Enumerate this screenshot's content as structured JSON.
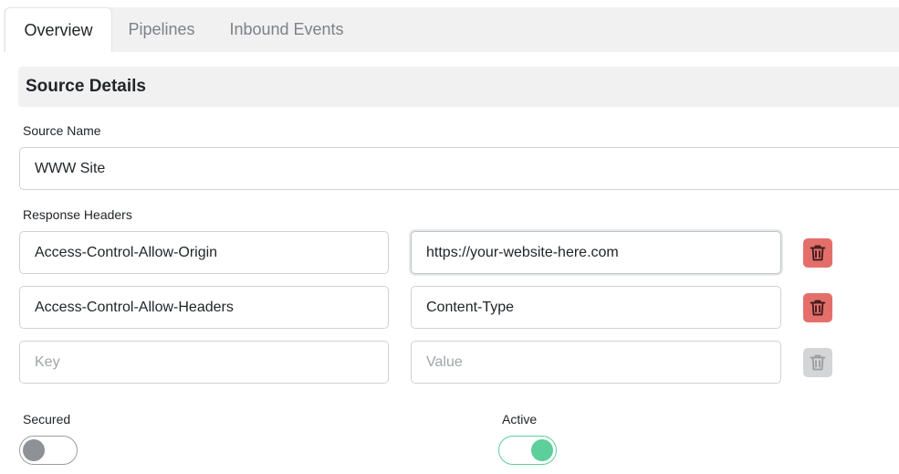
{
  "tabs": [
    {
      "label": "Overview",
      "active": true
    },
    {
      "label": "Pipelines",
      "active": false
    },
    {
      "label": "Inbound Events",
      "active": false
    }
  ],
  "section": {
    "title": "Source Details"
  },
  "source_name": {
    "label": "Source Name",
    "value": "WWW Site"
  },
  "response_headers": {
    "label": "Response Headers",
    "rows": [
      {
        "key": "Access-Control-Allow-Origin",
        "value": "https://your-website-here.com",
        "delete_enabled": true
      },
      {
        "key": "Access-Control-Allow-Headers",
        "value": "Content-Type",
        "delete_enabled": true
      },
      {
        "key": "",
        "value": "",
        "delete_enabled": false
      }
    ],
    "key_placeholder": "Key",
    "value_placeholder": "Value"
  },
  "secured": {
    "label": "Secured",
    "on": false
  },
  "active": {
    "label": "Active",
    "on": true
  },
  "icons": {
    "delete": "trash-icon"
  },
  "colors": {
    "delete": "#e46f6a",
    "delete_disabled": "#d4d5d6",
    "toggle_on": "#5ccf9a",
    "toggle_off": "#8e9196"
  }
}
